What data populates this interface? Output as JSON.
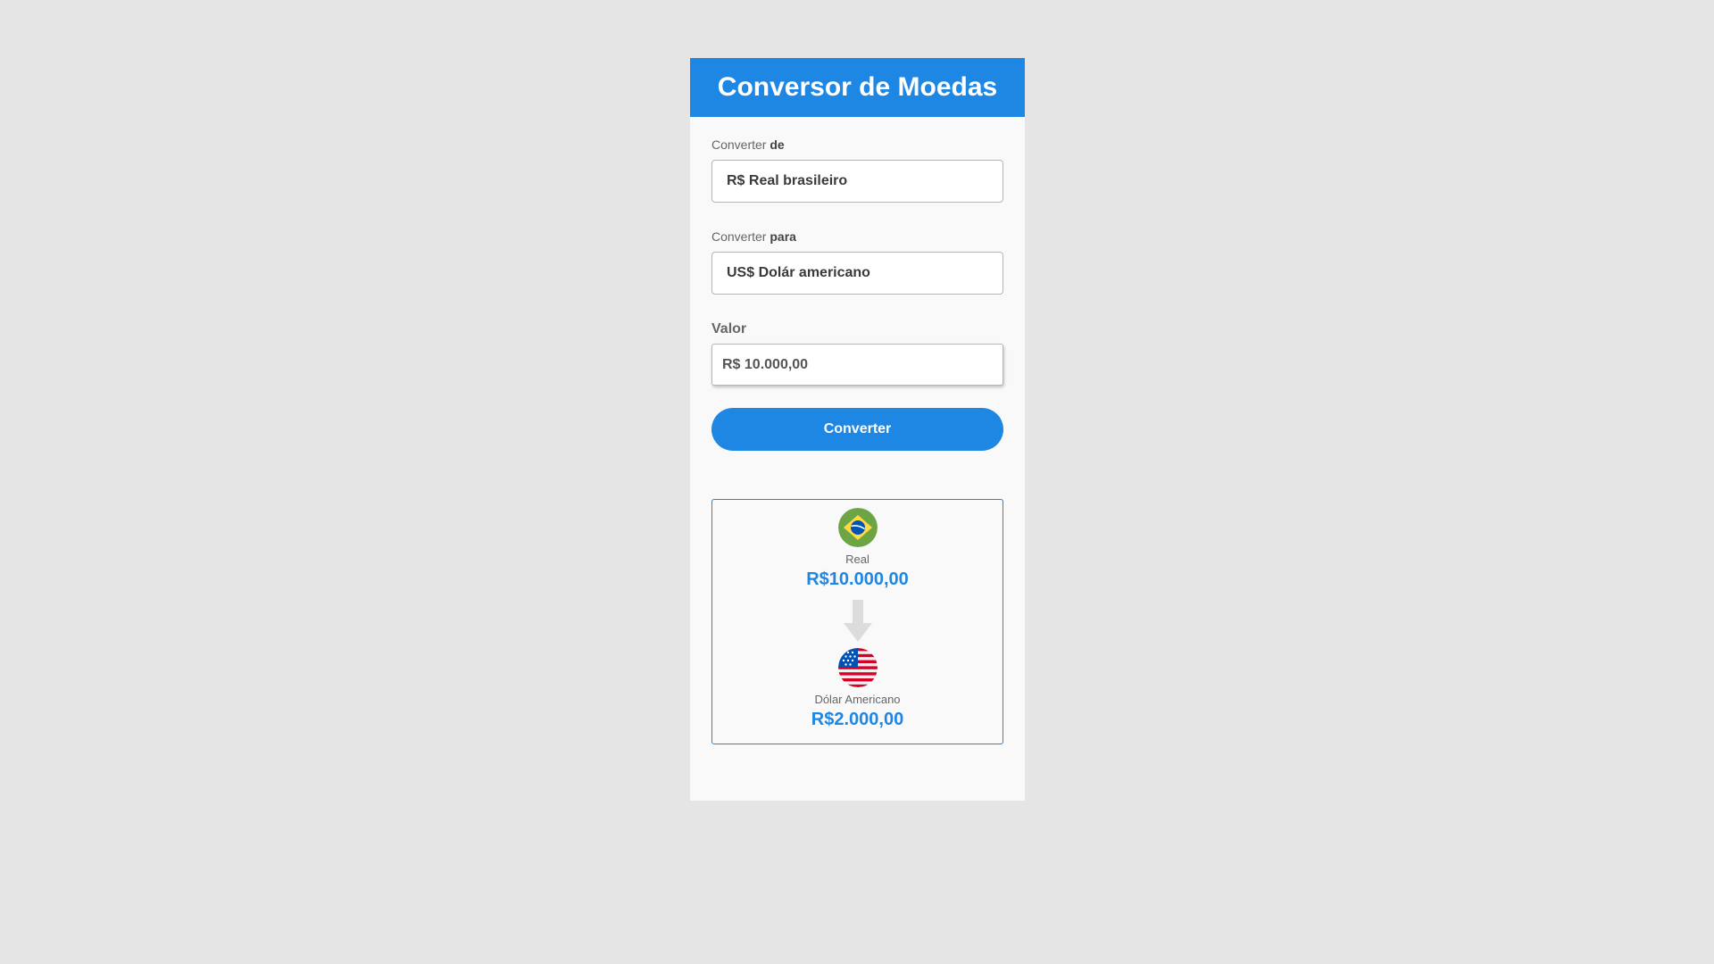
{
  "header": {
    "title": "Conversor de Moedas"
  },
  "form": {
    "from_label_prefix": "Converter",
    "from_label_bold": "de",
    "from_value": "R$ Real brasileiro",
    "to_label_prefix": "Converter",
    "to_label_bold": "para",
    "to_value": "US$ Dolár americano",
    "amount_label": "Valor",
    "amount_value": "R$ 10.000,00",
    "convert_button": "Converter"
  },
  "result": {
    "from": {
      "flag_icon": "brazil-flag-icon",
      "name": "Real",
      "value": "R$10.000,00"
    },
    "arrow_icon": "arrow-down-icon",
    "to": {
      "flag_icon": "usa-flag-icon",
      "name": "Dólar Americano",
      "value": "R$2.000,00"
    }
  },
  "colors": {
    "accent": "#1e86e3",
    "background": "#e5e5e5",
    "panel": "#f9f9f9"
  }
}
